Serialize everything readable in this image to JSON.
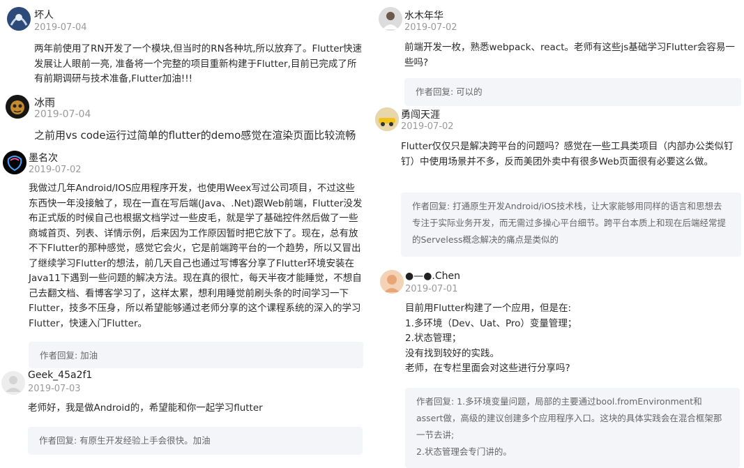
{
  "left": {
    "comments": [
      {
        "name": "坏人",
        "date": "2019-07-04",
        "body": "两年前使用了RN开发了一个模块,但当时的RN各种坑,所以放弃了。Flutter快速发展让人眼前一亮, 准备将一个完整的项目重新构建于Flutter,目前已完成了所有前期调研与技术准备,Flutter加油!!!"
      },
      {
        "name": "冰雨",
        "date": "2019-07-04",
        "body": "之前用vs code运行过简单的flutter的demo感觉在渲染页面比较流畅"
      },
      {
        "name": "墨名次",
        "date": "2019-07-02",
        "body": "我做过几年Android/IOS应用程序开发，也使用Weex写过公司项目，不过这些东西快一年没接触了，现在一直在写后端(Java、.Net)跟Web前端，Flutter没发布正式版的时候自己也根据文档学过一些皮毛，就是学了基础控件然后做了一些商城首页、列表、详情示例，后来因为工作原因暂时把它放下了。现在，总有放不下Flutter的那种感觉，感觉它会火，它是前端跨平台的一个趋势，所以又冒出了继续学习Flutter的想法，前几天自己也通过写博客分享了Flutter环境安装在Java11下遇到一些问题的解决方法。现在真的很忙，每天半夜才能睡觉，不想自己去翻文档、看博客学习了，这样太累，想利用睡觉前刷头条的时间学习一下Flutter，技多不压身，所以希望能够通过老师分享的这个课程系统的深入的学习Flutter，快速入门Flutter。",
        "reply": "作者回复: 加油"
      },
      {
        "name": "Geek_45a2f1",
        "date": "2019-07-03",
        "body": "老师好，我是做Android的，希望能和你一起学习flutter",
        "reply": "作者回复: 有原生开发经验上手会很快。加油"
      }
    ]
  },
  "right": {
    "comments": [
      {
        "name": "水木年华",
        "date": "2019-07-02",
        "body": "前端开发一枚，熟悉webpack、react。老师有这些js基础学习Flutter会容易一些吗?",
        "reply": "作者回复: 可以的"
      },
      {
        "name": "勇闯天涯",
        "date": "2019-07-02",
        "body": "Flutter仅仅只是解决跨平台的问题吗？感觉在一些工具类项目（内部办公类似钉钉）中使用场景并不多，反而美团外卖中有很多Web页面很有必要这么做。",
        "reply": "作者回复: 打通原生开发Android/iOS技术栈，让大家能够用同样的语言和思想去专注于实际业务开发，而无需过多操心平台细节。跨平台本质上和现在后端经常提的Serveless概念解决的痛点是类似的"
      },
      {
        "name": "●—●.Chen",
        "date": "2019-07-01",
        "body_lines": [
          "目前用Flutter构建了一个应用，但是在:",
          "1.多环境（Dev、Uat、Pro）变量管理；",
          "2.状态管理；",
          "没有找到较好的实践。",
          "老师，在专栏里面会对这些进行分享吗?"
        ],
        "reply_lines": [
          "作者回复: 1.多环境变量问题，局部的主要通过bool.fromEnvironment和assert做，高级的建议创建多个应用程序入口。这块的具体实践会在混合框架那一节去讲;",
          "2.状态管理会专门讲的。"
        ]
      }
    ]
  }
}
